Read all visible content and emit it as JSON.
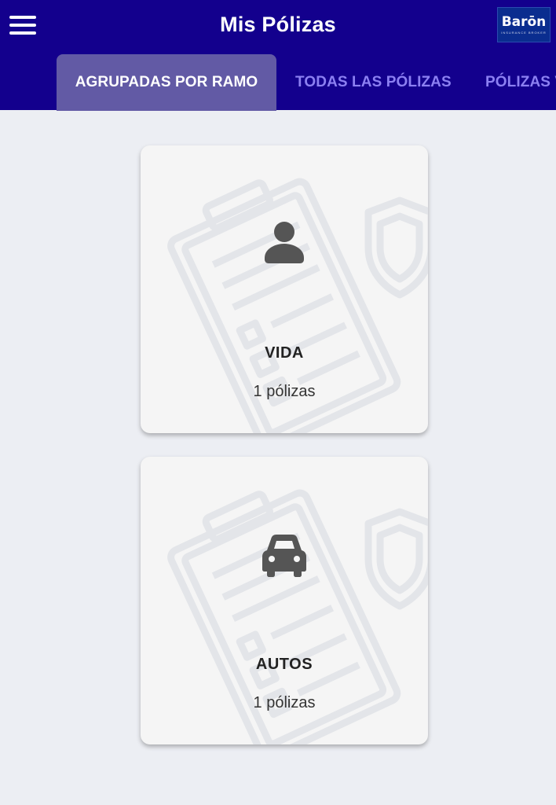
{
  "header": {
    "title": "Mis Pólizas",
    "menu_icon": "hamburger-menu-icon",
    "logo": {
      "text": "Barōn",
      "subtitle": "INSURANCE BROKER"
    },
    "background": "#13008d"
  },
  "tabs": [
    {
      "label": "AGRUPADAS POR RAMO",
      "active": true
    },
    {
      "label": "TODAS LAS PÓLIZAS",
      "active": false
    },
    {
      "label": "PÓLIZAS V",
      "active": false
    }
  ],
  "categories": [
    {
      "name": "VIDA",
      "count": "1 pólizas",
      "icon": "person-icon"
    },
    {
      "name": "AUTOS",
      "count": "1 pólizas",
      "icon": "car-icon"
    }
  ]
}
